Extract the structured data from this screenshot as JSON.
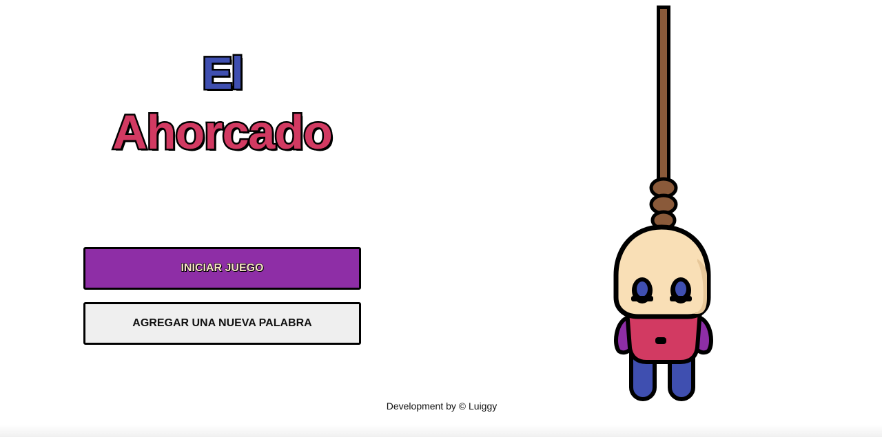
{
  "title": {
    "line1": "El",
    "line2": "Ahorcado"
  },
  "buttons": {
    "start_label": "INICIAR JUEGO",
    "add_word_label": "AGREGAR UNA NUEVA PALABRA"
  },
  "footer": {
    "credit": "Development by © Luiggy"
  },
  "colors": {
    "title_el": "#3f4fb0",
    "title_ahorcado": "#d23a62",
    "start_button_bg": "#8e2ea6",
    "start_button_text": "#f6e4c4",
    "add_button_bg": "#efefef",
    "rope": "#8a5a3a",
    "skin": "#f9dfb6",
    "shirt": "#d23a62",
    "arms": "#8e2ea6",
    "legs": "#3f4fb0"
  },
  "illustration": {
    "icon": "hanged-man-icon"
  }
}
